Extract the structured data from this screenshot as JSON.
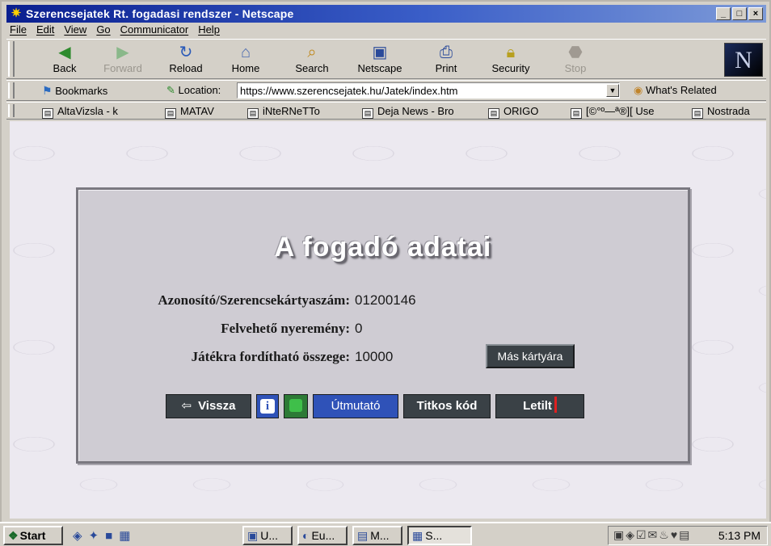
{
  "window": {
    "title": "Szerencsejatek Rt. fogadasi rendszer - Netscape",
    "controls": [
      "_",
      "□",
      "×"
    ]
  },
  "menu": [
    "File",
    "Edit",
    "View",
    "Go",
    "Communicator",
    "Help"
  ],
  "toolbar": {
    "buttons": [
      {
        "label": "Back",
        "icon": "back-arrow-icon",
        "disabled": false
      },
      {
        "label": "Forward",
        "icon": "forward-arrow-icon",
        "disabled": true
      },
      {
        "label": "Reload",
        "icon": "reload-icon",
        "disabled": false
      },
      {
        "label": "Home",
        "icon": "home-icon",
        "disabled": false
      },
      {
        "label": "Search",
        "icon": "search-icon",
        "disabled": false
      },
      {
        "label": "Netscape",
        "icon": "netscape-icon",
        "disabled": false
      },
      {
        "label": "Print",
        "icon": "print-icon",
        "disabled": false
      },
      {
        "label": "Security",
        "icon": "lock-icon",
        "disabled": false
      },
      {
        "label": "Stop",
        "icon": "stop-icon",
        "disabled": true
      }
    ],
    "logo": "N"
  },
  "location": {
    "bookmarks_label": "Bookmarks",
    "location_label": "Location:",
    "url": "https://www.szerencsejatek.hu/Jatek/index.htm",
    "related_label": "What's Related"
  },
  "personal_toolbar": [
    "AltaVizsla - k",
    "MATAV",
    "iNteRNeTTo",
    "Deja News - Bro",
    "ORIGO",
    "[©°º—ª®][ Use",
    "Nostrada"
  ],
  "page": {
    "heading": "A fogadó adatai",
    "fields": [
      {
        "label": "Azonosító/Szerencsekártyaszám:",
        "value": "01200146"
      },
      {
        "label": "Felvehető nyeremény:",
        "value": "0"
      },
      {
        "label": "Játékra fordítható összege:",
        "value": "10000"
      }
    ],
    "other_card_button": "Más kártyára",
    "nav": {
      "back": "Vissza",
      "info": "i",
      "guide": "Útmutató",
      "secret_code": "Titkos kód",
      "block": "Letilt"
    }
  },
  "taskbar": {
    "start": "Start",
    "tasks": [
      "U...",
      "Eu...",
      "M...",
      "S..."
    ],
    "clock": "5:13 PM"
  }
}
